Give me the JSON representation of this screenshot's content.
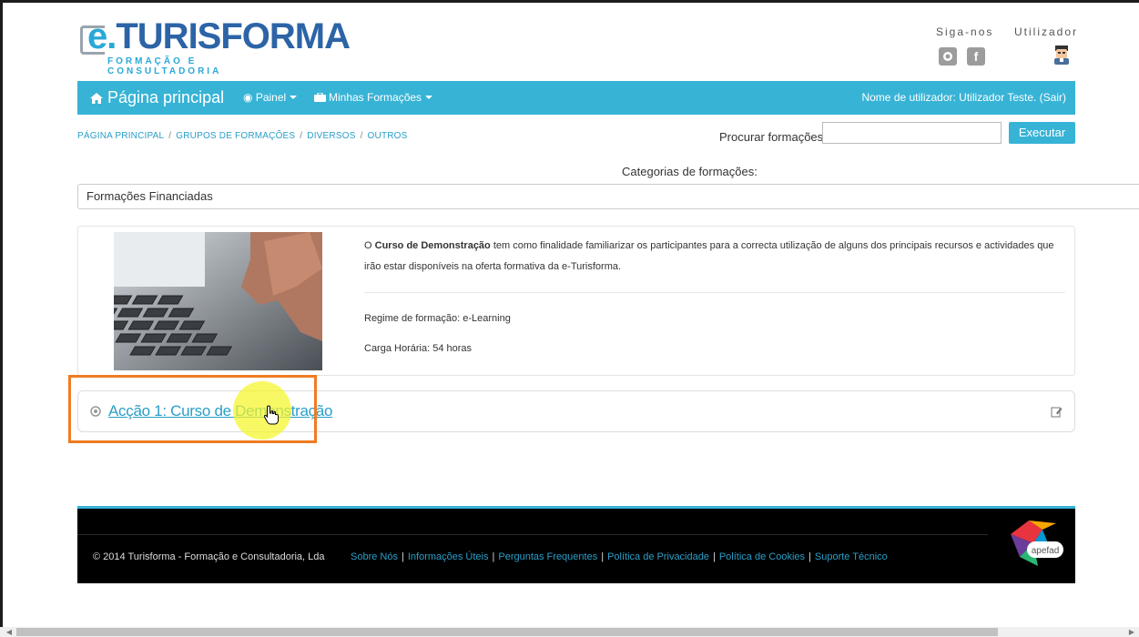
{
  "header": {
    "logo_main": "TURISFORMA",
    "logo_sub": "FORMAÇÃO E CONSULTADORIA",
    "social_label": "Siga-nos",
    "user_label": "Utilizador"
  },
  "nav": {
    "home": "Página principal",
    "painel": "Painel",
    "formacoes": "Minhas Formações",
    "user_status": "Nome de utilizador: Utilizador Teste. (Sair)"
  },
  "breadcrumb": [
    "PÁGINA PRINCIPAL",
    "GRUPOS DE FORMAÇÕES",
    "DIVERSOS",
    "OUTROS"
  ],
  "search": {
    "label": "Procurar formações:",
    "value": "",
    "button": "Executar"
  },
  "categories": {
    "label": "Categorias de formações:",
    "selected": "Formações Financiadas"
  },
  "course": {
    "desc_prefix": "O ",
    "desc_bold": "Curso de Demonstração",
    "desc_rest": " tem como finalidade familiarizar os participantes para a correcta utilização de alguns dos principais recursos e actividades que irão estar disponíveis na oferta formativa da e-Turisforma.",
    "regime": "Regime de formação: e-Learning",
    "carga": "Carga Horária: 54 horas"
  },
  "action": {
    "link": "Acção 1: Curso de Demonstração"
  },
  "footer": {
    "copyright": "© 2014 Turisforma - Formação e Consultadoria, Lda",
    "links": [
      "Sobre Nós",
      "Informações Úteis",
      "Perguntas Frequentes",
      "Política de Privacidade",
      "Política de Cookies",
      "Suporte Técnico"
    ],
    "badge": "apefad"
  },
  "colors": {
    "accent": "#37b3d6",
    "link": "#2a9fc9",
    "highlight": "#f07b22"
  }
}
